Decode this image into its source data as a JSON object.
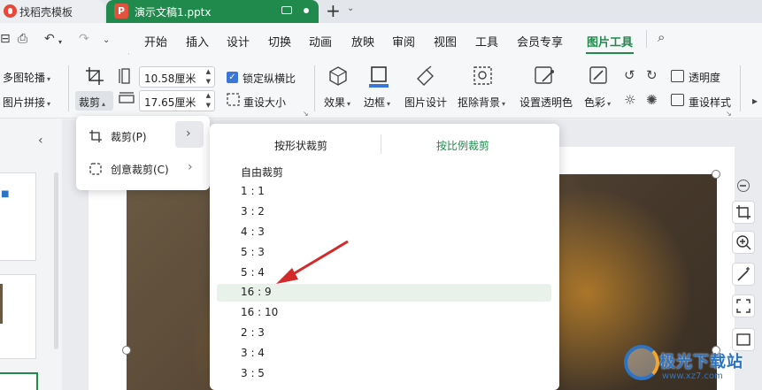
{
  "tabs": {
    "template_tab": "找稻壳模板",
    "doc_tab": "演示文稿1.pptx",
    "doc_icon_letter": "P",
    "new_tab": "+",
    "new_tab_menu": "⌄"
  },
  "menu": {
    "items": [
      "开始",
      "插入",
      "设计",
      "切换",
      "动画",
      "放映",
      "审阅",
      "视图",
      "工具",
      "会员专享",
      "图片工具"
    ],
    "active": "图片工具",
    "active_color": "#1f8a4c"
  },
  "ribbon": {
    "multi_outline": "多图轮播",
    "image_stitch": "图片拼接",
    "crop": "裁剪",
    "width_value": "10.58厘米",
    "height_value": "17.65厘米",
    "lock_ratio": "锁定纵横比",
    "reset_size": "重设大小",
    "effects": "效果",
    "border": "边框",
    "image_design": "图片设计",
    "remove_bg": "抠除背景",
    "set_transparent": "设置透明色",
    "color": "色彩",
    "transparency": "透明度",
    "reset_style": "重设样式"
  },
  "crop_menu": {
    "crop": "裁剪(P)",
    "creative_crop": "创意裁剪(C)"
  },
  "ratio_menu": {
    "tab_shape": "按形状裁剪",
    "tab_ratio": "按比例裁剪",
    "options": [
      "自由裁剪",
      "1 : 1",
      "3 : 2",
      "4 : 3",
      "5 : 3",
      "5 : 4",
      "16 : 9",
      "16 : 10",
      "2 : 3",
      "3 : 4",
      "3 : 5"
    ],
    "highlighted": "16 : 9"
  },
  "watermark": {
    "text": "极光下载站",
    "url": "www.xz7.com"
  },
  "colors": {
    "accent_green": "#1f8a4c",
    "arrow_red": "#d42a2a",
    "checkbox_blue": "#3a75d8"
  }
}
